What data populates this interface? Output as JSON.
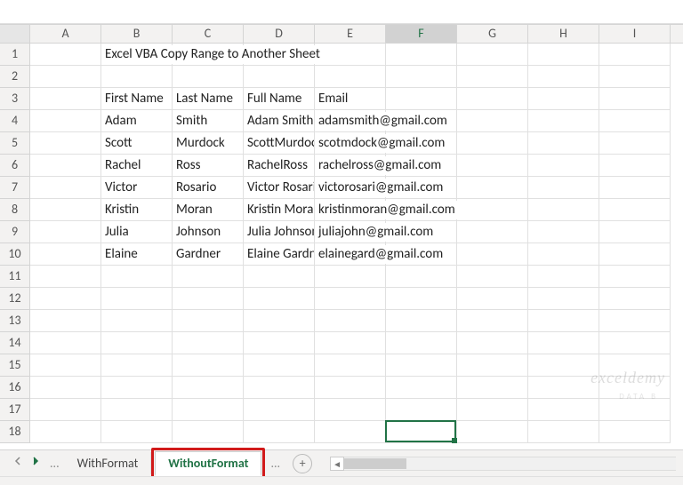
{
  "columns": [
    "A",
    "B",
    "C",
    "D",
    "E",
    "F",
    "G",
    "H",
    "I"
  ],
  "row_count": 18,
  "active_cell": {
    "col": "F",
    "row": 18,
    "col_index": 5,
    "row_index": 17
  },
  "title_cell": {
    "row": 1,
    "col": "B",
    "text": "Excel VBA Copy Range to Another Sheet"
  },
  "headers_row": 3,
  "headers": [
    "First Name",
    "Last Name",
    "Full Name",
    "Email"
  ],
  "data_start_row": 4,
  "data": [
    {
      "first": "Adam",
      "last": "Smith",
      "full": "Adam Smith",
      "email": "adamsmith@gmail.com"
    },
    {
      "first": "Scott",
      "last": "Murdock",
      "full": "ScottMurdock",
      "email": "scotmdock@gmail.com"
    },
    {
      "first": "Rachel",
      "last": "Ross",
      "full": "RachelRoss",
      "email": "rachelross@gmail.com"
    },
    {
      "first": "Victor",
      "last": "Rosario",
      "full": "Victor Rosario",
      "email": "victorosari@gmail.com"
    },
    {
      "first": "Kristin",
      "last": "Moran",
      "full": "Kristin Moran",
      "email": "kristinmoran@gmail.com"
    },
    {
      "first": "Julia",
      "last": "Johnson",
      "full": "Julia Johnson",
      "email": "juliajohn@gmail.com"
    },
    {
      "first": "Elaine",
      "last": "Gardner",
      "full": "Elaine Gardner",
      "email": "elainegard@gmail.com"
    }
  ],
  "tabs": {
    "inactive": "WithFormat",
    "active": "WithoutFormat"
  },
  "watermark": "exceldemy",
  "watermark_sub": "DATA B"
}
